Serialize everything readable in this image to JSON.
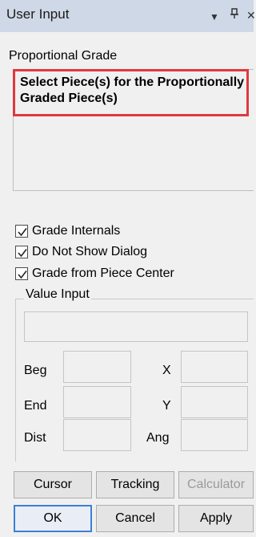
{
  "window": {
    "title": "User Input",
    "dropdown_glyph": "▼",
    "pin_glyph": "⊥",
    "close_glyph": "✕"
  },
  "section": {
    "label": "Proportional Grade"
  },
  "prompt": {
    "text": "Select Piece(s) for the Proportionally Graded Piece(s)",
    "highlight_color": "#e0393e"
  },
  "options": [
    {
      "label": "Grade Internals",
      "checked": true
    },
    {
      "label": "Do Not Show Dialog",
      "checked": true
    },
    {
      "label": "Grade from Piece Center",
      "checked": true
    }
  ],
  "value_input": {
    "label": "Value Input",
    "main_value": "",
    "fields": {
      "beg": {
        "label": "Beg",
        "value": ""
      },
      "end": {
        "label": "End",
        "value": ""
      },
      "dist": {
        "label": "Dist",
        "value": ""
      },
      "x": {
        "label": "X",
        "value": ""
      },
      "y": {
        "label": "Y",
        "value": ""
      },
      "ang": {
        "label": "Ang",
        "value": ""
      }
    }
  },
  "buttons": {
    "cursor": "Cursor",
    "tracking": "Tracking",
    "calculator": "Calculator",
    "ok": "OK",
    "cancel": "Cancel",
    "apply": "Apply"
  },
  "colors": {
    "titlebar": "#cfd8e6",
    "default_button_border": "#3c7fd6",
    "disabled_text": "#9a9a9a"
  }
}
